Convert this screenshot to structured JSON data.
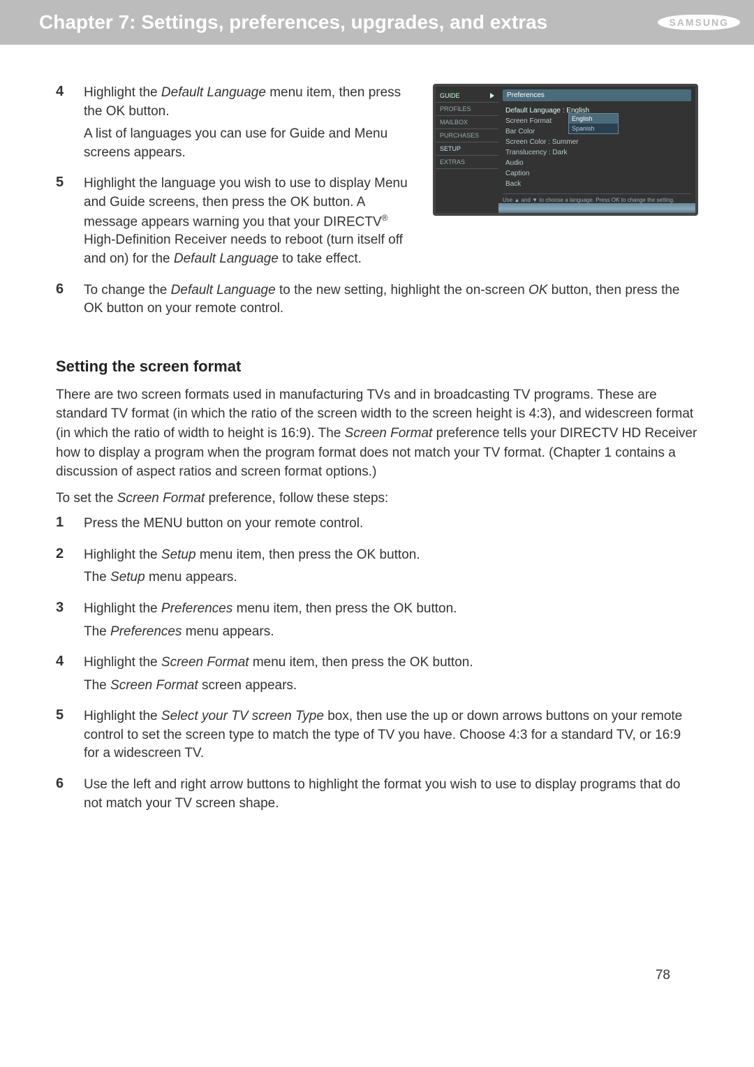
{
  "header": {
    "chapter_title": "Chapter 7: Settings, preferences, upgrades, and extras",
    "brand": "SAMSUNG"
  },
  "figure": {
    "left_items": {
      "guide": "GUIDE",
      "profiles": "PROFILES",
      "mailbox": "MAILBOX",
      "purchases": "PURCHASES",
      "setup": "SETUP",
      "extras": "EXTRAS"
    },
    "panel_title": "Preferences",
    "lines": {
      "default_language": "Default Language : English",
      "screen_format": "Screen Format",
      "bar_color": "Bar Color",
      "screen_color": "Screen Color : Summer",
      "translucency": "Translucency : Dark",
      "audio": "Audio",
      "caption": "Caption",
      "back": "Back"
    },
    "lang_options": {
      "english": "English",
      "spanish": "Spanish"
    },
    "footer": "Use ▲ and ▼ to choose a language.\nPress OK to change the setting."
  },
  "steps_a": {
    "s4": {
      "num": "4",
      "p1_a": "Highlight the ",
      "p1_i": "Default Language",
      "p1_b": " menu item, then press the OK button.",
      "p2": "A list of languages you can use for Guide and Menu screens appears."
    },
    "s5": {
      "num": "5",
      "p1_a": "Highlight the language you wish to use to display Menu and Guide screens, then press the OK button. A message appears warning you that your DIRECTV",
      "p1_sup": "®",
      "p1_b": " High-Definition Receiver needs to reboot (turn itself off and on) for the ",
      "p1_i": "Default Language",
      "p1_c": " to take effect."
    },
    "s6": {
      "num": "6",
      "p1_a": "To change the ",
      "p1_i1": "Default Language",
      "p1_b": " to the new setting, highlight the on-screen ",
      "p1_i2": "OK",
      "p1_c": " button, then press the OK button on your remote control."
    }
  },
  "section2": {
    "heading": "Setting the screen format",
    "para1_a": "There are two screen formats used in manufacturing TVs and in broadcasting TV programs. These are standard TV format (in which the ratio of the screen width to the screen height is 4:3), and widescreen format (in which the ratio of width to height is 16:9). The ",
    "para1_i": "Screen Format",
    "para1_b": " preference tells your DIRECTV HD Receiver how to display a program when the program format does not match your TV format. (Chapter 1 contains a discussion of aspect ratios and screen format options.)",
    "para2_a": "To set the ",
    "para2_i": "Screen Format",
    "para2_b": " preference, follow these steps:"
  },
  "steps_b": {
    "s1": {
      "num": "1",
      "p1": "Press the MENU button on your remote control."
    },
    "s2": {
      "num": "2",
      "p1_a": "Highlight the ",
      "p1_i": "Setup",
      "p1_b": " menu item, then press the OK button.",
      "p2_a": "The ",
      "p2_i": "Setup",
      "p2_b": " menu appears."
    },
    "s3": {
      "num": "3",
      "p1_a": "Highlight the ",
      "p1_i": "Preferences",
      "p1_b": " menu item, then press the OK button.",
      "p2_a": "The ",
      "p2_i": "Preferences",
      "p2_b": " menu appears."
    },
    "s4": {
      "num": "4",
      "p1_a": "Highlight the ",
      "p1_i": "Screen Format",
      "p1_b": " menu item, then press the OK button.",
      "p2_a": "The ",
      "p2_i": "Screen Format",
      "p2_b": " screen appears."
    },
    "s5": {
      "num": "5",
      "p1_a": "Highlight the ",
      "p1_i": "Select your TV screen Type",
      "p1_b": " box, then use the up or down arrows buttons on your remote control to set the screen type to match the type of TV you have. Choose 4:3 for a standard TV, or 16:9 for a widescreen TV."
    },
    "s6": {
      "num": "6",
      "p1": "Use the left and right arrow buttons to highlight the format you wish to use to display programs that do not match your TV screen shape."
    }
  },
  "page_number": "78"
}
